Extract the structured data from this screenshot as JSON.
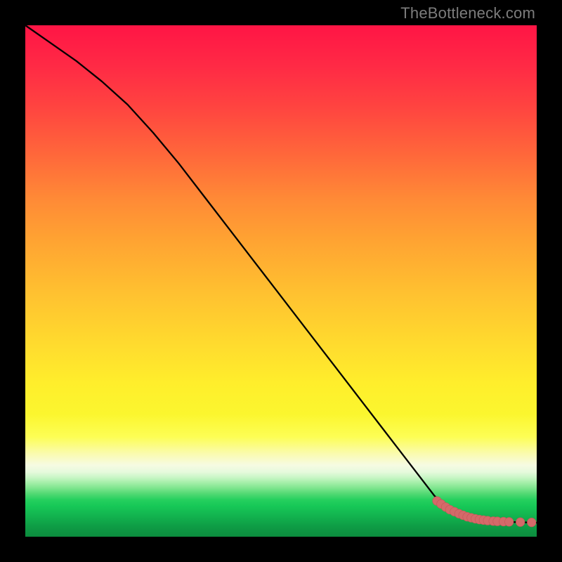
{
  "attribution": "TheBottleneck.com",
  "colors": {
    "line": "#000000",
    "marker_fill": "#d46a6a",
    "marker_stroke": "#c85a5a"
  },
  "chart_data": {
    "type": "line",
    "title": "",
    "xlabel": "",
    "ylabel": "",
    "xlim": [
      0,
      100
    ],
    "ylim": [
      0,
      100
    ],
    "grid": false,
    "legend": false,
    "series": [
      {
        "name": "curve",
        "style": "line",
        "x": [
          0,
          5,
          10,
          15,
          20,
          25,
          30,
          35,
          40,
          45,
          50,
          55,
          60,
          65,
          70,
          75,
          80,
          82,
          84,
          86,
          88,
          90,
          92,
          94,
          96,
          98,
          100
        ],
        "y": [
          100,
          96.5,
          93,
          89,
          84.5,
          79,
          73,
          66.5,
          60,
          53.5,
          47,
          40.5,
          34,
          27.5,
          21,
          14.5,
          8,
          6.2,
          5.0,
          4.1,
          3.5,
          3.2,
          3.0,
          2.9,
          2.85,
          2.8,
          2.75
        ]
      },
      {
        "name": "markers",
        "style": "points",
        "x": [
          80.5,
          81.3,
          82.2,
          83.0,
          83.9,
          84.8,
          85.6,
          86.4,
          87.2,
          88.0,
          88.8,
          89.6,
          90.4,
          91.5,
          92.3,
          93.5,
          94.6,
          96.8,
          99.0
        ],
        "y": [
          7.0,
          6.4,
          5.8,
          5.3,
          4.9,
          4.5,
          4.2,
          3.9,
          3.7,
          3.5,
          3.35,
          3.25,
          3.15,
          3.05,
          3.0,
          2.95,
          2.9,
          2.85,
          2.8
        ]
      }
    ]
  }
}
